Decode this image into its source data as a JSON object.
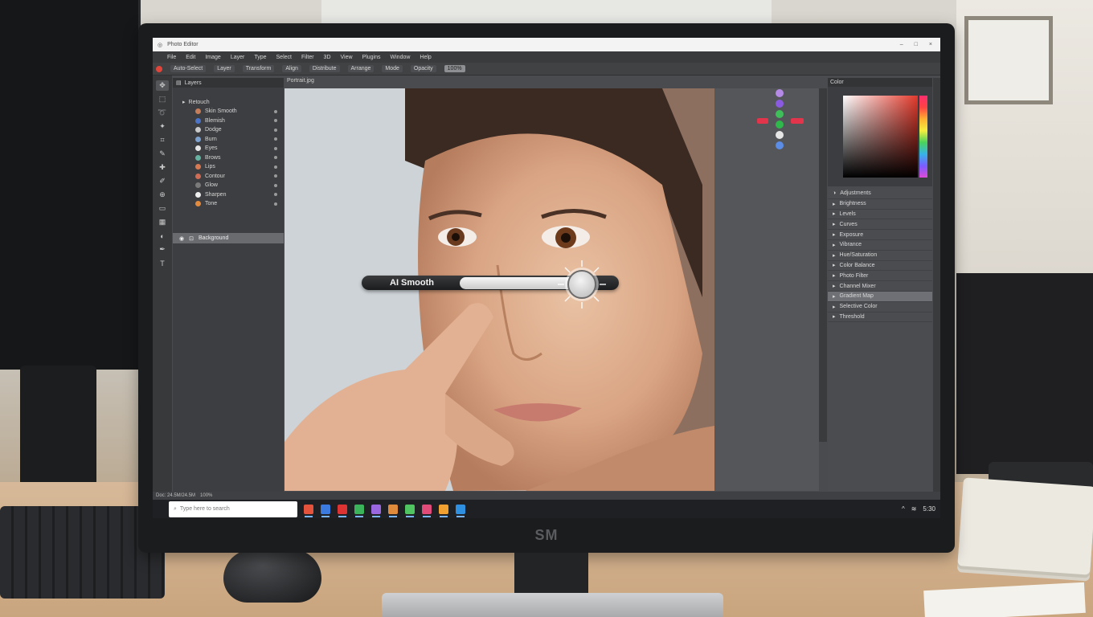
{
  "scene": {
    "monitor_brand": "SM"
  },
  "app": {
    "title": "Photo Editor",
    "window_controls": [
      "–",
      "□",
      "×"
    ],
    "menu": [
      "File",
      "Edit",
      "Image",
      "Layer",
      "Type",
      "Select",
      "Filter",
      "3D",
      "View",
      "Plugins",
      "Window",
      "Help"
    ],
    "options": [
      "Auto-Select",
      "Layer",
      "Transform",
      "Align",
      "Distribute",
      "Arrange",
      "Mode",
      "Opacity"
    ],
    "options_highlight": "100%",
    "document_tab": "Portrait.jpg",
    "layers_header": "Layers",
    "layers_group": "Retouch",
    "layers": [
      {
        "name": "Skin Smooth",
        "color": "#c67d5a"
      },
      {
        "name": "Blemish",
        "color": "#4b74c9"
      },
      {
        "name": "Dodge",
        "color": "#c9c9c9"
      },
      {
        "name": "Burn",
        "color": "#7da2cf"
      },
      {
        "name": "Eyes",
        "color": "#e6e6e6"
      },
      {
        "name": "Brows",
        "color": "#65b3a0"
      },
      {
        "name": "Lips",
        "color": "#d77a54"
      },
      {
        "name": "Contour",
        "color": "#cf6c55"
      },
      {
        "name": "Glow",
        "color": "#7a7a7a"
      },
      {
        "name": "Sharpen",
        "color": "#eeeeee"
      },
      {
        "name": "Tone",
        "color": "#e28a3e"
      }
    ],
    "selected_layer": "Background",
    "slider": {
      "label": "AI Smooth",
      "value_fraction": 0.92
    },
    "color_panel_header": "Color",
    "adjust_header": "Adjustments",
    "adjustments": [
      "Brightness",
      "Levels",
      "Curves",
      "Exposure",
      "Vibrance",
      "Hue/Saturation",
      "Color Balance",
      "Photo Filter",
      "Channel Mixer",
      "Gradient Map",
      "Selective Color",
      "Threshold"
    ],
    "selected_adjustment_index": 9,
    "status": [
      "Doc: 24.5M/24.5M",
      "100%"
    ],
    "search_placeholder": "Type here to search",
    "tray_text": "5:30",
    "colors": {
      "accent": "#e0453b",
      "panel": "#3d3e41",
      "canvas_bg": "#55565a"
    }
  }
}
